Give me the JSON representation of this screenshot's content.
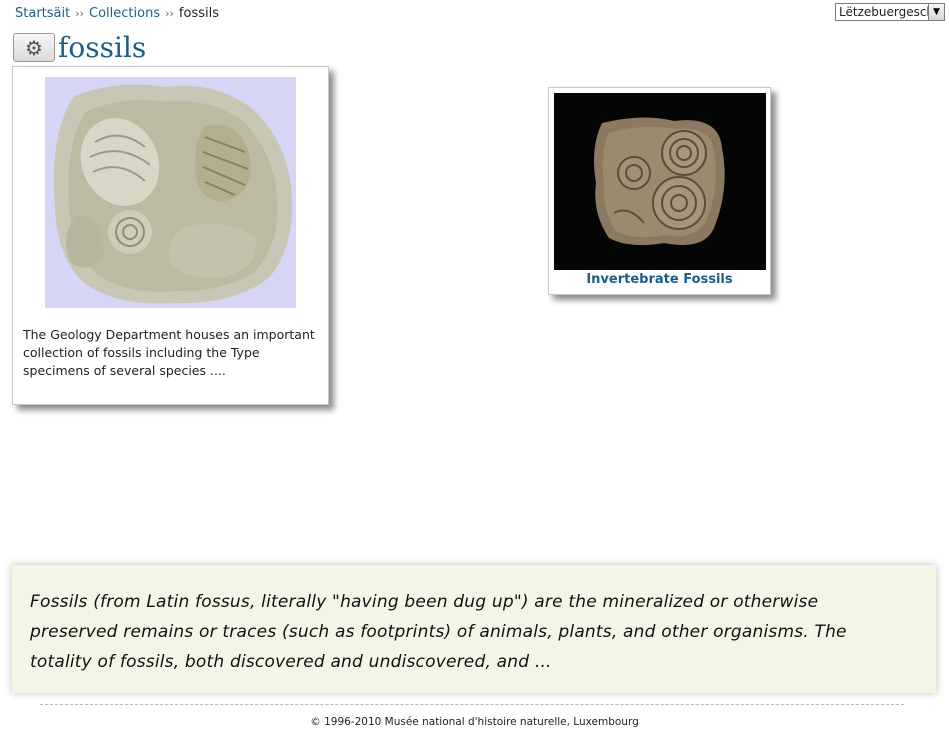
{
  "breadcrumb": {
    "home": "Startsäit",
    "collections": "Collections",
    "current": "fossils",
    "separator": "››"
  },
  "language_select": {
    "value": "Lëtzebuergesch"
  },
  "title": {
    "text": "fossils",
    "settings_icon": "gear-icon"
  },
  "cards": [
    {
      "description": "The Geology Department houses an important collection of fossils including the Type specimens of several species ...."
    },
    {
      "caption": "Invertebrate Fossils"
    }
  ],
  "quote": {
    "text": "Fossils (from Latin fossus, literally \"having been dug up\") are the mineralized or otherwise preserved remains or traces (such as footprints) of animals, plants, and other organisms. The totality of fossils, both discovered and undiscovered, and ..."
  },
  "footer": {
    "copyright": "© 1996-2010 Musée national d'histoire naturelle, Luxembourg"
  },
  "colors": {
    "link": "#1d5e88",
    "quote_background": "#f5f5e6",
    "thumb_background": "#d7d5f6"
  }
}
